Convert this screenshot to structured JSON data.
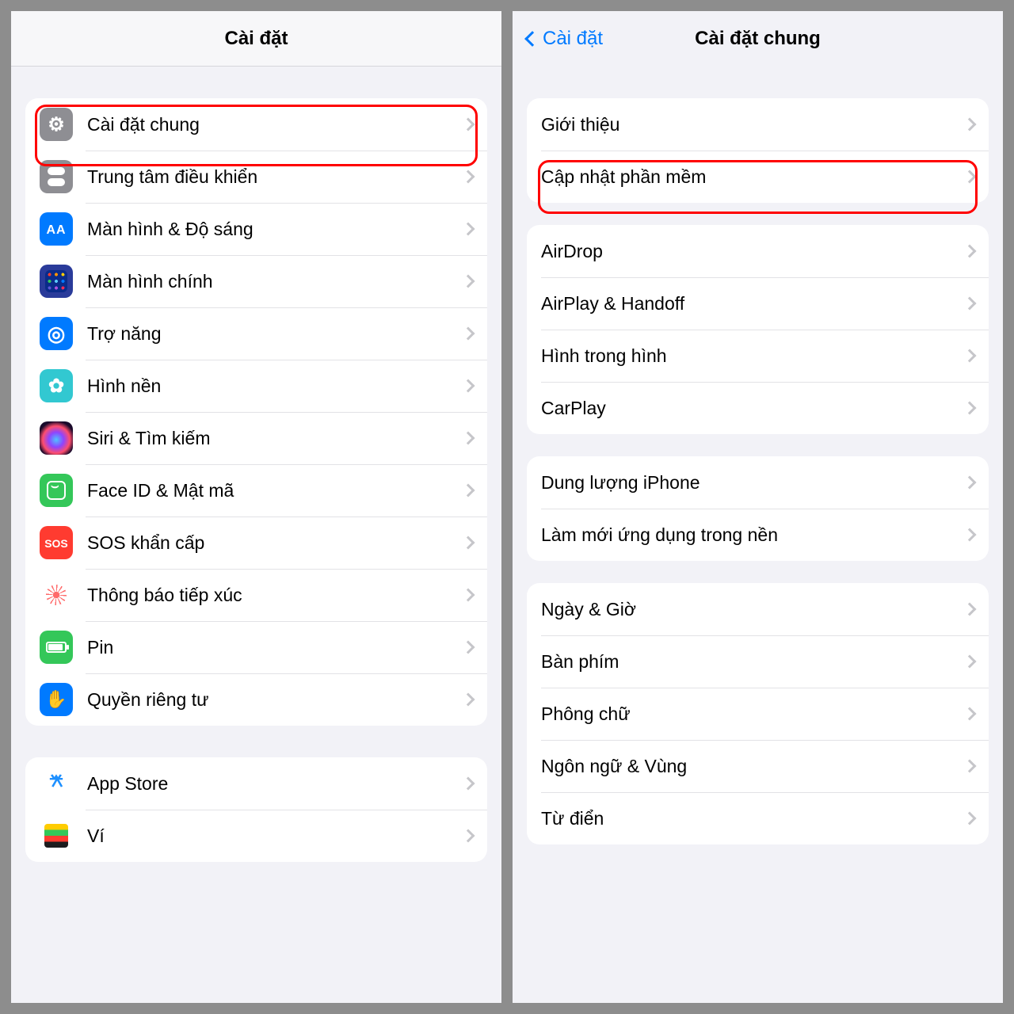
{
  "left": {
    "title": "Cài đặt",
    "group1": [
      {
        "label": "Cài đặt chung",
        "icon": "gear-icon",
        "bg": "bg-grey"
      },
      {
        "label": "Trung tâm điều khiển",
        "icon": "control-center-icon",
        "bg": "bg-grey"
      },
      {
        "label": "Màn hình & Độ sáng",
        "icon": "display-icon",
        "bg": "bg-blue"
      },
      {
        "label": "Màn hình chính",
        "icon": "home-screen-icon",
        "bg": "bg-blue"
      },
      {
        "label": "Trợ năng",
        "icon": "accessibility-icon",
        "bg": "bg-blue"
      },
      {
        "label": "Hình nền",
        "icon": "wallpaper-icon",
        "bg": "bg-teal"
      },
      {
        "label": "Siri & Tìm kiếm",
        "icon": "siri-icon",
        "bg": "bg-black"
      },
      {
        "label": "Face ID & Mật mã",
        "icon": "faceid-icon",
        "bg": "bg-green"
      },
      {
        "label": "SOS khẩn cấp",
        "icon": "sos-icon",
        "bg": "bg-red"
      },
      {
        "label": "Thông báo tiếp xúc",
        "icon": "exposure-icon",
        "bg": "bg-white"
      },
      {
        "label": "Pin",
        "icon": "battery-icon",
        "bg": "bg-green"
      },
      {
        "label": "Quyền riêng tư",
        "icon": "privacy-icon",
        "bg": "bg-blue"
      }
    ],
    "group2": [
      {
        "label": "App Store",
        "icon": "appstore-icon",
        "bg": "bg-white"
      },
      {
        "label": "Ví",
        "icon": "wallet-icon",
        "bg": "bg-white"
      }
    ]
  },
  "right": {
    "back_label": "Cài đặt",
    "title": "Cài đặt chung",
    "group1": [
      {
        "label": "Giới thiệu"
      },
      {
        "label": "Cập nhật phần mềm"
      }
    ],
    "group2": [
      {
        "label": "AirDrop"
      },
      {
        "label": "AirPlay & Handoff"
      },
      {
        "label": "Hình trong hình"
      },
      {
        "label": "CarPlay"
      }
    ],
    "group3": [
      {
        "label": "Dung lượng iPhone"
      },
      {
        "label": "Làm mới ứng dụng trong nền"
      }
    ],
    "group4": [
      {
        "label": "Ngày & Giờ"
      },
      {
        "label": "Bàn phím"
      },
      {
        "label": "Phông chữ"
      },
      {
        "label": "Ngôn ngữ & Vùng"
      },
      {
        "label": "Từ điển"
      }
    ]
  },
  "highlight_color": "#ff0000"
}
